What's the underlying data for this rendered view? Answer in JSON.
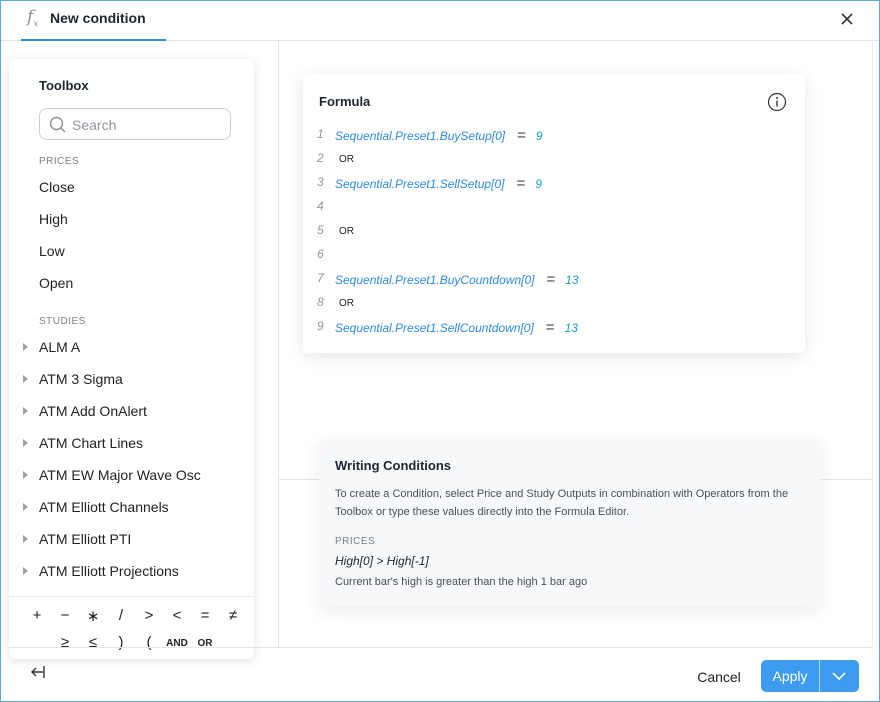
{
  "header": {
    "title": "New condition",
    "fx_icon": "fx-icon",
    "close_icon": "close-icon"
  },
  "toolbox": {
    "title": "Toolbox",
    "search_placeholder": "Search",
    "prices_label": "PRICES",
    "prices": [
      "Close",
      "High",
      "Low",
      "Open"
    ],
    "studies_label": "STUDIES",
    "studies": [
      "ALM A",
      "ATM 3 Sigma",
      "ATM Add OnAlert",
      "ATM Chart Lines",
      "ATM EW Major Wave Osc",
      "ATM Elliott Channels",
      "ATM Elliott PTI",
      "ATM Elliott Projections"
    ],
    "operators_row1": [
      "+",
      "−",
      "∗",
      "/",
      ">",
      "<",
      "=",
      "≠"
    ],
    "operators_row2": [
      "≥",
      "≤",
      ")",
      "(",
      "AND",
      "OR"
    ]
  },
  "formula": {
    "title": "Formula",
    "lines": [
      {
        "num": "1",
        "code": "Sequential.Preset1.BuySetup[0]",
        "op": "=",
        "value": "9",
        "keyword": ""
      },
      {
        "num": "2",
        "code": "",
        "op": "",
        "value": "",
        "keyword": "OR"
      },
      {
        "num": "3",
        "code": "Sequential.Preset1.SellSetup[0]",
        "op": "=",
        "value": "9",
        "keyword": ""
      },
      {
        "num": "4",
        "code": "",
        "op": "",
        "value": "",
        "keyword": ""
      },
      {
        "num": "5",
        "code": "",
        "op": "",
        "value": "",
        "keyword": "OR"
      },
      {
        "num": "6",
        "code": "",
        "op": "",
        "value": "",
        "keyword": ""
      },
      {
        "num": "7",
        "code": "Sequential.Preset1.BuyCountdown[0]",
        "op": "=",
        "value": "13",
        "keyword": ""
      },
      {
        "num": "8",
        "code": "",
        "op": "",
        "value": "",
        "keyword": "OR"
      },
      {
        "num": "9",
        "code": "Sequential.Preset1.SellCountdown[0]",
        "op": "=",
        "value": "13",
        "keyword": ""
      }
    ]
  },
  "writing_conditions": {
    "title": "Writing Conditions",
    "description": "To create a Condition, select Price and Study Outputs in combination with Operators from the Toolbox or type these values directly into the Formula Editor.",
    "example_label": "PRICES",
    "example": "High[0] > High[-1]",
    "example_note": "Current bar's high is greater than the high 1 bar ago"
  },
  "footer": {
    "cancel_label": "Cancel",
    "apply_label": "Apply"
  },
  "colors": {
    "accent": "#3d9bf0",
    "code": "#2a8be0",
    "value": "#16a0c4"
  }
}
